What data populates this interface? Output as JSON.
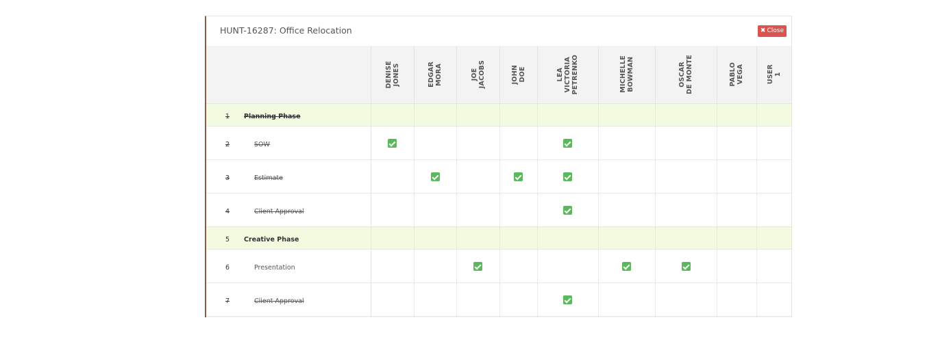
{
  "modal": {
    "title": "HUNT-16287: Office Relocation",
    "close_label": "Close"
  },
  "users": [
    {
      "name": "DENISE\nJONES"
    },
    {
      "name": "EDGAR\nMORA"
    },
    {
      "name": "JOE\nJACOBS"
    },
    {
      "name": "JOHN\nDOE"
    },
    {
      "name": "LEA\nVICTORIA\nPETRENKO"
    },
    {
      "name": "MICHELLE\nBOWMAN"
    },
    {
      "name": "OSCAR\nDE MONTE"
    },
    {
      "name": "PABLO\nVEGA"
    },
    {
      "name": "USER\n1"
    }
  ],
  "rows": [
    {
      "num": "1",
      "label": "Planning Phase",
      "type": "phase",
      "struck": true,
      "checks": [
        0,
        0,
        0,
        0,
        0,
        0,
        0,
        0,
        0
      ]
    },
    {
      "num": "2",
      "label": "SOW",
      "type": "task",
      "struck": true,
      "checks": [
        1,
        0,
        0,
        0,
        1,
        0,
        0,
        0,
        0
      ]
    },
    {
      "num": "3",
      "label": "Estimate",
      "type": "task",
      "struck": true,
      "checks": [
        0,
        1,
        0,
        1,
        1,
        0,
        0,
        0,
        0
      ]
    },
    {
      "num": "4",
      "label": "Client Approval",
      "type": "task",
      "struck": true,
      "checks": [
        0,
        0,
        0,
        0,
        1,
        0,
        0,
        0,
        0
      ]
    },
    {
      "num": "5",
      "label": "Creative Phase",
      "type": "phase",
      "struck": false,
      "checks": [
        0,
        0,
        0,
        0,
        0,
        0,
        0,
        0,
        0
      ]
    },
    {
      "num": "6",
      "label": "Presentation",
      "type": "task",
      "struck": false,
      "checks": [
        0,
        0,
        1,
        0,
        0,
        1,
        1,
        0,
        0
      ]
    },
    {
      "num": "7",
      "label": "Client Approval",
      "type": "task",
      "struck": true,
      "checks": [
        0,
        0,
        0,
        0,
        1,
        0,
        0,
        0,
        0
      ]
    }
  ],
  "colors": {
    "phase_bg": "#f2fbe0",
    "check": "#5cb85c",
    "close": "#d9534f"
  }
}
